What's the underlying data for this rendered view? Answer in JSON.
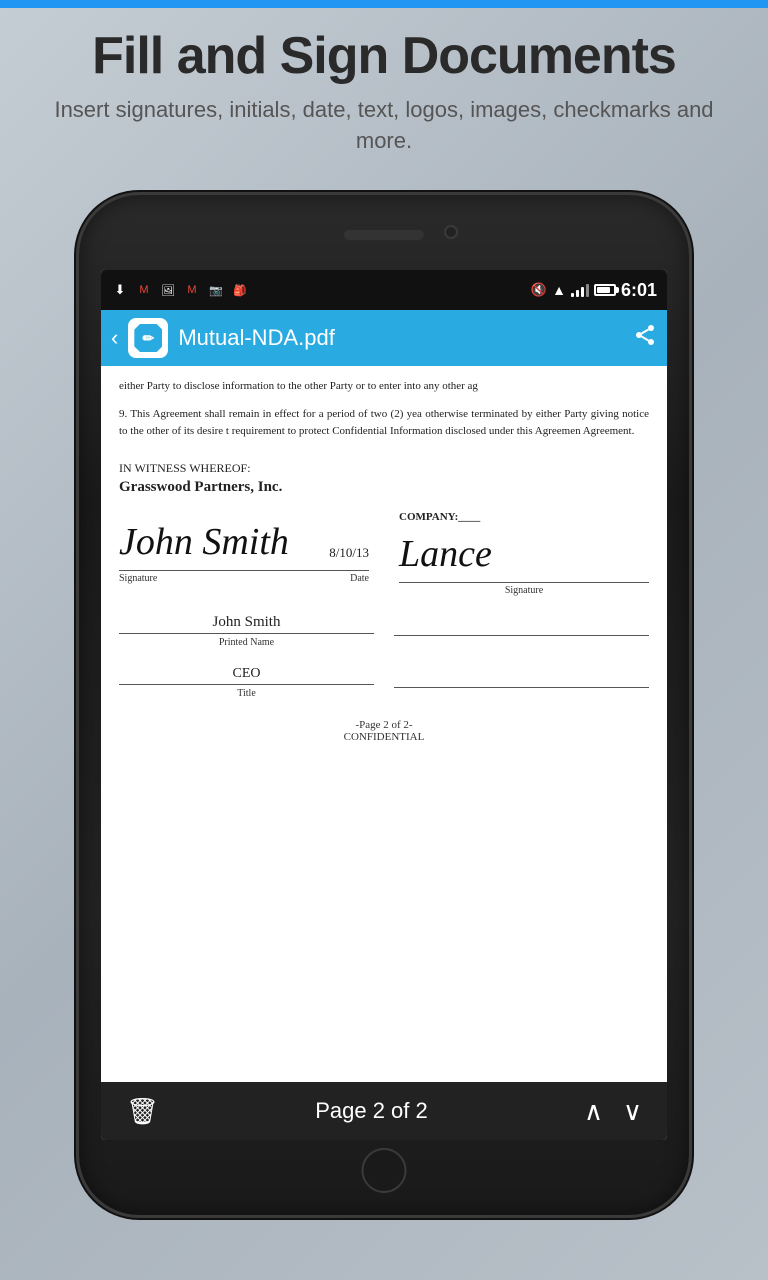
{
  "top_bar": {
    "color": "#2196F3"
  },
  "header": {
    "title": "Fill and Sign Documents",
    "subtitle": "Insert signatures, initials, date, text, logos, images, checkmarks and more."
  },
  "status_bar": {
    "time": "6:01",
    "icons": [
      "download",
      "gmail",
      "image",
      "gmail",
      "camera",
      "bag",
      "mute",
      "wifi",
      "signal",
      "battery"
    ]
  },
  "toolbar": {
    "back_label": "‹",
    "filename": "Mutual-NDA.pdf",
    "share_icon": "share"
  },
  "document": {
    "paragraph1": "either Party to disclose information to the other Party or to enter into any other ag",
    "paragraph2": "9.        This Agreement shall remain in effect for a period of two (2) yea otherwise terminated by either Party giving notice to the other of its desire t requirement to protect Confidential Information disclosed under this Agreemen Agreement.",
    "witness_header": "IN WITNESS WHEREOF:",
    "company_name": "Grasswood Partners, Inc.",
    "company_label": "COMPANY:____",
    "signature1_name": "John Smith",
    "signature1_style": "cursive",
    "signature1_date": "8/10/13",
    "signature1_label": "Signature",
    "date_label": "Date",
    "signature2_name": "Lance",
    "signature2_label": "Signature",
    "printed_name": "John Smith",
    "printed_name_label": "Printed Name",
    "title_value": "CEO",
    "title_label": "Title",
    "page_footer_line1": "-Page 2 of 2-",
    "page_footer_line2": "CONFIDENTIAL"
  },
  "bottom_nav": {
    "trash_icon": "trash",
    "page_info": "Page 2 of 2",
    "up_arrow": "∧",
    "down_arrow": "∨"
  }
}
